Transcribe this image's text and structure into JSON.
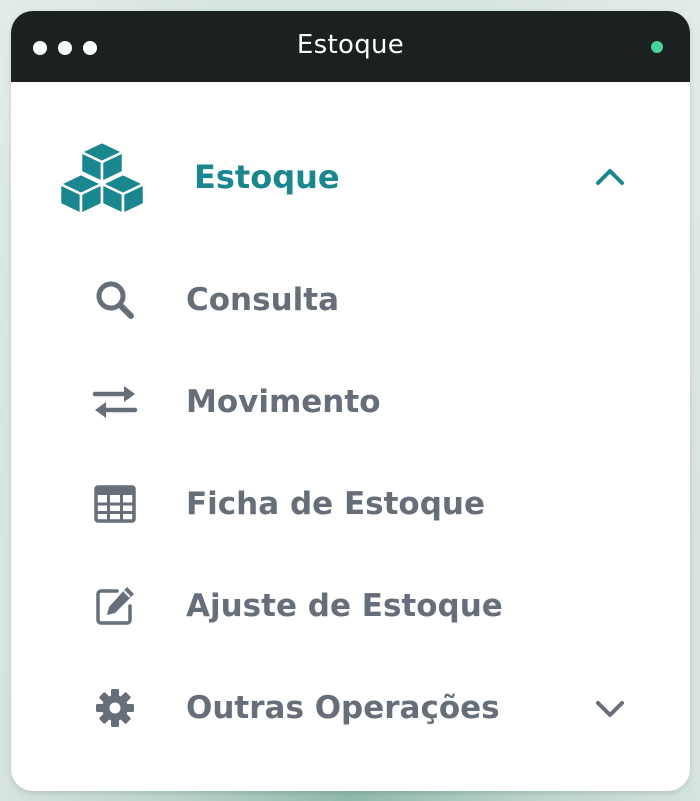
{
  "window": {
    "title": "Estoque",
    "status_color": "#44d39a"
  },
  "menu": {
    "header": {
      "label": "Estoque",
      "icon": "boxes-icon",
      "expanded": true,
      "accent_color": "#1a868f"
    },
    "items": [
      {
        "label": "Consulta",
        "icon": "search-icon"
      },
      {
        "label": "Movimento",
        "icon": "arrows-exchange-icon"
      },
      {
        "label": "Ficha de Estoque",
        "icon": "table-icon"
      },
      {
        "label": "Ajuste de Estoque",
        "icon": "edit-icon"
      },
      {
        "label": "Outras Operações",
        "icon": "gear-icon",
        "has_submenu": true,
        "expanded": false
      }
    ],
    "item_text_color": "#666e79"
  }
}
